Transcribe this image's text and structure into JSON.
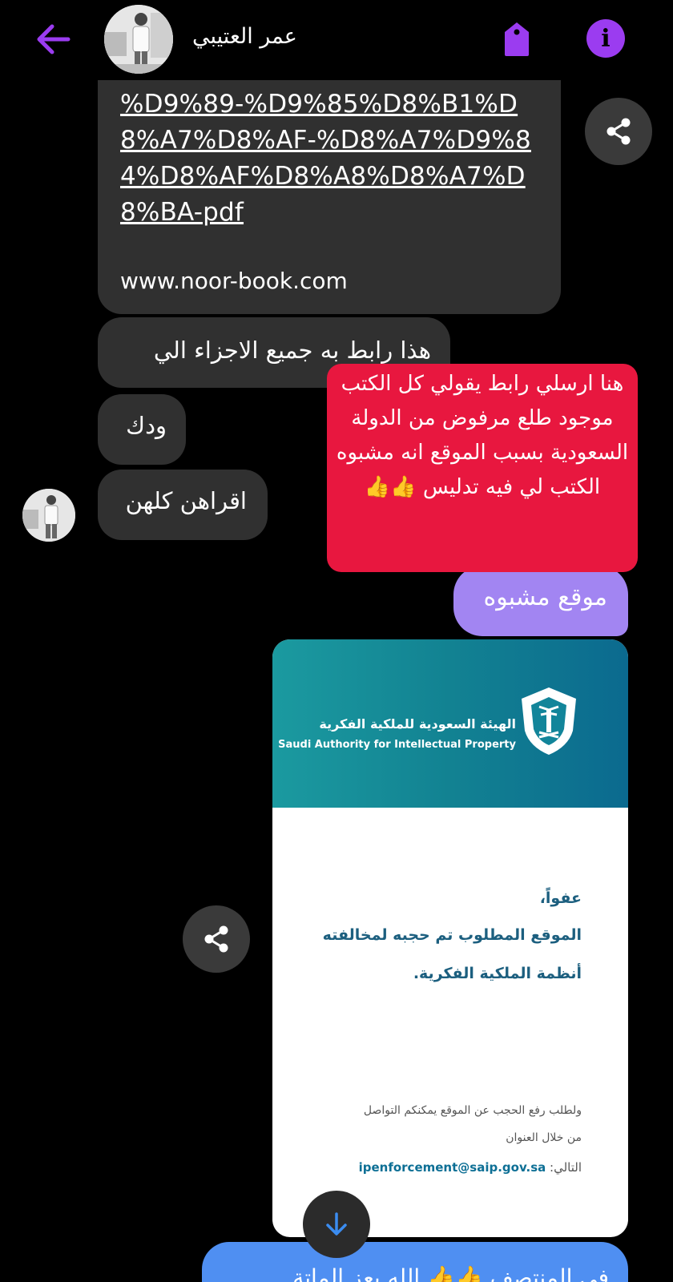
{
  "header": {
    "contact_name": "عمر العتيبي",
    "accent_color": "#9b3cf0",
    "icons": [
      "back-arrow-icon",
      "tag-icon",
      "info-icon"
    ]
  },
  "messages": {
    "link_url": "%D9%89-%D9%85%D8%B1%D8%A7%D8%AF-%D8%A7%D9%84%D8%AF%D8%A8%D8%A7%D8%BA-pdf",
    "link_domain": "www.noor-book.com",
    "all_parts": "هذا رابط به جميع الاجزاء الي",
    "wadak": "ودك",
    "iqrahen": "اقراهن كلهن",
    "sent_suspicious": "موقع مشبوه",
    "bottom_partial": "في المنتصف 👍👍 الله يعز الماتة"
  },
  "annotation": {
    "text": "هنا ارسلي رابط يقولي كل الكتب موجود طلع مرفوض من الدولة السعودية بسبب الموقع انه مشبوه الكتب لي فيه تدليس 👍👍",
    "color": "#e8173f"
  },
  "image": {
    "org_name_ar": "الهيئة السعودية للملكية الفكرية",
    "org_name_en": "Saudi Authority for Intellectual Property",
    "sorry": "عفواً،",
    "blocked_line1": "الموقع المطلوب تم حجبه لمخالفته",
    "blocked_line2": "أنظمة الملكية الفكرية.",
    "request_line1": "ولطلب رفع الحجب عن الموقع يمكنكم التواصل",
    "request_line2": "من خلال العنوان",
    "request_line3_prefix": "التالي:",
    "email": "ipenforcement@saip.gov.sa"
  }
}
